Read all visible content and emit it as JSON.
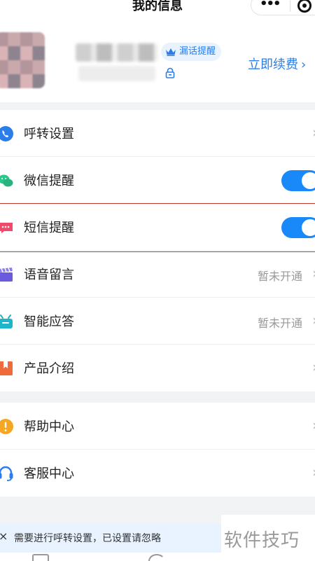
{
  "nav": {
    "title": "我的信息",
    "more_label": "•••"
  },
  "profile": {
    "badge": "漏话提醒",
    "renew": "立即续费",
    "chevron": "›"
  },
  "settings": [
    {
      "key": "call-forward",
      "label": "呼转设置",
      "icon": "phone-forward-icon",
      "type": "arrow"
    },
    {
      "key": "wechat-remind",
      "label": "微信提醒",
      "icon": "wechat-icon",
      "type": "toggle",
      "on": true
    },
    {
      "key": "sms-remind",
      "label": "短信提醒",
      "icon": "sms-icon",
      "type": "toggle",
      "on": true
    },
    {
      "key": "voicemail",
      "label": "语音留言",
      "icon": "clapper-icon",
      "type": "status",
      "status": "暂未开通"
    },
    {
      "key": "smart-answer",
      "label": "智能应答",
      "icon": "robot-icon",
      "type": "status",
      "status": "暂未开通"
    },
    {
      "key": "product-intro",
      "label": "产品介绍",
      "icon": "bookmark-icon",
      "type": "arrow"
    }
  ],
  "support": [
    {
      "key": "help-center",
      "label": "帮助中心",
      "icon": "exclamation-icon"
    },
    {
      "key": "service-center",
      "label": "客服中心",
      "icon": "headset-icon"
    }
  ],
  "notice": {
    "text": "需要进行呼转设置，已设置请忽略",
    "close": "×"
  },
  "watermark": "软件技巧",
  "colors": {
    "accent": "#1989fa",
    "link": "#2b7de9",
    "highlight": "#c0392b"
  }
}
